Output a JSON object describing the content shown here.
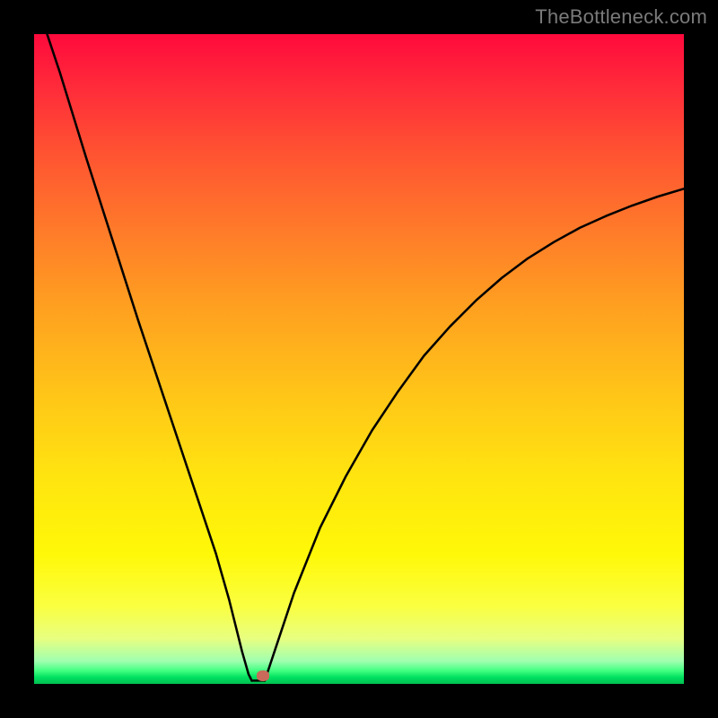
{
  "watermark": "TheBottleneck.com",
  "chart_data": {
    "type": "line",
    "title": "",
    "xlabel": "",
    "ylabel": "",
    "xlim": [
      0,
      100
    ],
    "ylim": [
      0,
      100
    ],
    "series": [
      {
        "name": "bottleneck-curve-left",
        "x": [
          0,
          4,
          8,
          12,
          16,
          20,
          24,
          28,
          30,
          31,
          32,
          33,
          33.5
        ],
        "values": [
          106,
          94,
          81,
          68.5,
          56,
          44,
          32,
          20,
          13,
          9,
          5,
          1.5,
          0.5
        ]
      },
      {
        "name": "bottleneck-curve-right",
        "x": [
          35.5,
          36,
          38,
          40,
          44,
          48,
          52,
          56,
          60,
          64,
          68,
          72,
          76,
          80,
          84,
          88,
          92,
          96,
          100
        ],
        "values": [
          0.5,
          2,
          8,
          14,
          24,
          32,
          39,
          45,
          50.5,
          55,
          59,
          62.5,
          65.5,
          68,
          70.2,
          72,
          73.6,
          75,
          76.2
        ]
      },
      {
        "name": "bottleneck-valley-floor",
        "x": [
          33.5,
          35.5
        ],
        "values": [
          0.5,
          0.5
        ]
      }
    ],
    "marker": {
      "x": 35.2,
      "y": 1.2
    },
    "gradient_stops": [
      {
        "pct": 0,
        "color": "#ff0a3c"
      },
      {
        "pct": 8,
        "color": "#ff2a3a"
      },
      {
        "pct": 18,
        "color": "#ff5232"
      },
      {
        "pct": 30,
        "color": "#ff7a2a"
      },
      {
        "pct": 42,
        "color": "#ffa020"
      },
      {
        "pct": 55,
        "color": "#ffc418"
      },
      {
        "pct": 68,
        "color": "#ffe410"
      },
      {
        "pct": 80,
        "color": "#fff808"
      },
      {
        "pct": 88,
        "color": "#faff40"
      },
      {
        "pct": 93,
        "color": "#e8ff80"
      },
      {
        "pct": 96.5,
        "color": "#a0ffb0"
      },
      {
        "pct": 98,
        "color": "#40ff80"
      },
      {
        "pct": 99,
        "color": "#00e060"
      },
      {
        "pct": 100,
        "color": "#00c050"
      }
    ]
  }
}
